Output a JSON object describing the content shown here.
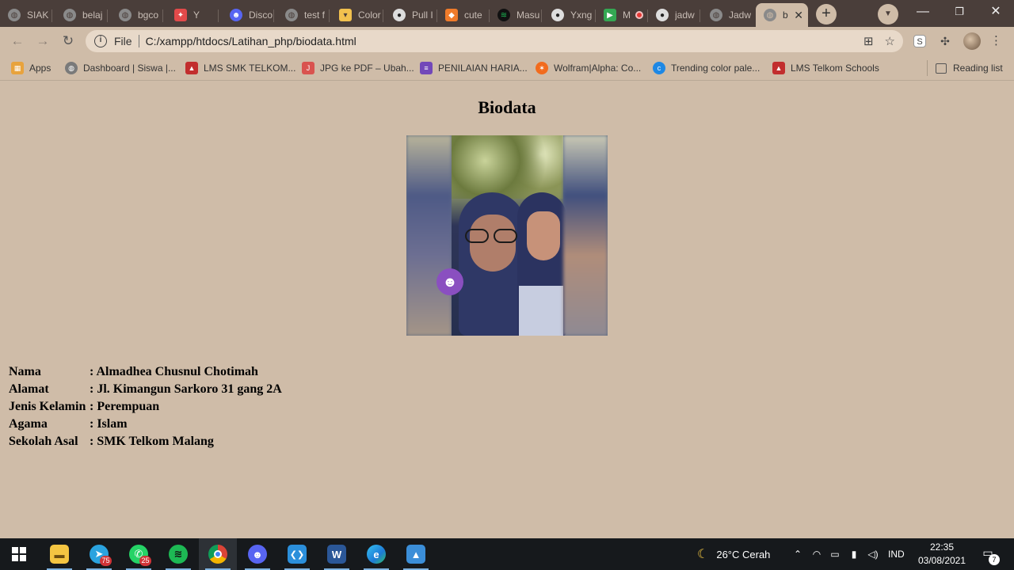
{
  "browser": {
    "tabs": [
      {
        "label": "SIAK",
        "icon": "globe-icon",
        "color": "#8a8a8a"
      },
      {
        "label": "belaj",
        "icon": "globe-icon",
        "color": "#8a8a8a"
      },
      {
        "label": "bgco",
        "icon": "globe-icon",
        "color": "#8a8a8a"
      },
      {
        "label": "Y",
        "icon": "rocket-icon",
        "color": "#e24a4a"
      },
      {
        "label": "Disco",
        "icon": "discord-icon",
        "color": "#5865f2"
      },
      {
        "label": "test f",
        "icon": "globe-icon",
        "color": "#8a8a8a"
      },
      {
        "label": "Color",
        "icon": "cup-icon",
        "color": "#f2c14e"
      },
      {
        "label": "Pull I",
        "icon": "github-icon",
        "color": "#dddddd"
      },
      {
        "label": "cute",
        "icon": "tag-icon",
        "color": "#f07b2a"
      },
      {
        "label": "Masu",
        "icon": "spotify-icon",
        "color": "#1db954"
      },
      {
        "label": "Yxng",
        "icon": "github-icon",
        "color": "#dddddd"
      },
      {
        "label": "M",
        "icon": "meet-icon",
        "color": "#34a853"
      },
      {
        "label": "jadw",
        "icon": "github-icon",
        "color": "#dddddd"
      },
      {
        "label": "Jadw",
        "icon": "globe-icon",
        "color": "#8a8a8a"
      },
      {
        "label": "b",
        "icon": "globe-icon",
        "color": "#8a8a8a"
      }
    ],
    "new_tab_label": "+",
    "minimize": "—",
    "restore": "❐",
    "close": "✕",
    "address": {
      "scheme": "File",
      "url": "C:/xampp/htdocs/Latihan_php/biodata.html"
    },
    "bookmarks": [
      {
        "label": "Apps",
        "color": "#e8a33d"
      },
      {
        "label": "Dashboard | Siswa |...",
        "color": "#7a7a7a"
      },
      {
        "label": "LMS SMK TELKOM...",
        "color": "#c22e2e"
      },
      {
        "label": "JPG ke PDF – Ubah...",
        "color": "#d9534f"
      },
      {
        "label": "PENILAIAN HARIA...",
        "color": "#7248b9"
      },
      {
        "label": "Wolfram|Alpha: Co...",
        "color": "#f26b1d"
      },
      {
        "label": "Trending color pale...",
        "color": "#1e88e5"
      },
      {
        "label": "LMS Telkom Schools",
        "color": "#c22e2e"
      }
    ],
    "reading_list": "Reading list"
  },
  "page": {
    "title": "Biodata",
    "rows": [
      {
        "key": "Nama",
        "value": ": Almadhea Chusnul Chotimah"
      },
      {
        "key": "Alamat",
        "value": ": Jl. Kimangun Sarkoro 31 gang 2A"
      },
      {
        "key": "Jenis Kelamin",
        "value": ": Perempuan"
      },
      {
        "key": "Agama",
        "value": ": Islam"
      },
      {
        "key": "Sekolah Asal",
        "value": ": SMK Telkom Malang"
      }
    ]
  },
  "taskbar": {
    "apps": [
      {
        "name": "file-explorer-icon",
        "color": "#f4c542",
        "glyph": "▬"
      },
      {
        "name": "telegram-icon",
        "color": "#2aa3df",
        "glyph": "➤",
        "badge": "75"
      },
      {
        "name": "whatsapp-icon",
        "color": "#25d366",
        "glyph": "✆",
        "badge": "25"
      },
      {
        "name": "spotify-icon",
        "color": "#1db954",
        "glyph": "≋"
      },
      {
        "name": "chrome-icon",
        "color": "#e4a73c",
        "glyph": "◉"
      },
      {
        "name": "discord-icon",
        "color": "#5865f2",
        "glyph": "☻"
      },
      {
        "name": "vscode-icon",
        "color": "#2b8fdb",
        "glyph": "❮❯"
      },
      {
        "name": "word-icon",
        "color": "#2b5797",
        "glyph": "W"
      },
      {
        "name": "edge-icon",
        "color": "#1f9fd9",
        "glyph": "e"
      },
      {
        "name": "photos-icon",
        "color": "#3b8ed8",
        "glyph": "▲"
      }
    ],
    "weather": "26°C  Cerah",
    "language": "IND",
    "time": "22:35",
    "date": "03/08/2021",
    "notifications": "7"
  }
}
